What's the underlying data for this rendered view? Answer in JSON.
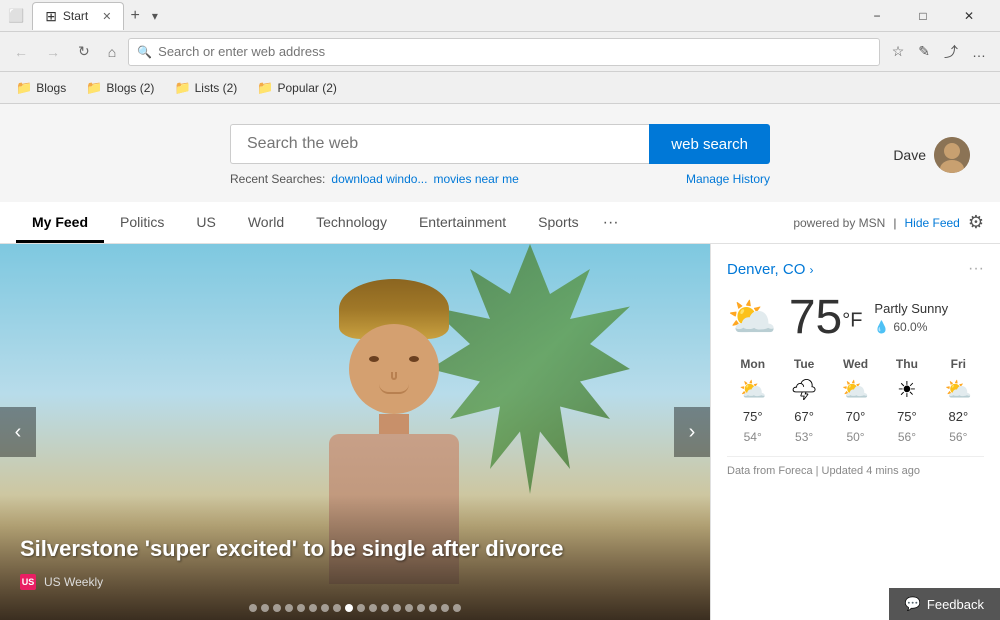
{
  "window": {
    "title": "Start",
    "min_label": "−",
    "max_label": "□",
    "close_label": "✕"
  },
  "address_bar": {
    "placeholder": "Search or enter web address",
    "back_icon": "←",
    "forward_icon": "→",
    "refresh_icon": "↻",
    "home_icon": "⌂",
    "favorite_icon": "☆",
    "reading_icon": "📖",
    "share_icon": "⤴",
    "more_icon": "…"
  },
  "bookmarks": [
    {
      "label": "Blogs",
      "type": "folder"
    },
    {
      "label": "Blogs (2)",
      "type": "folder"
    },
    {
      "label": "Lists (2)",
      "type": "folder"
    },
    {
      "label": "Popular (2)",
      "type": "folder"
    }
  ],
  "search": {
    "placeholder": "Search the web",
    "button_label": "web search",
    "recent_label": "Recent Searches:",
    "recent_items": [
      "download windo...",
      "movies near me"
    ],
    "manage_history": "Manage History"
  },
  "user": {
    "name": "Dave"
  },
  "feed": {
    "tabs": [
      {
        "label": "My Feed",
        "active": true
      },
      {
        "label": "Politics",
        "active": false
      },
      {
        "label": "US",
        "active": false
      },
      {
        "label": "World",
        "active": false
      },
      {
        "label": "Technology",
        "active": false
      },
      {
        "label": "Entertainment",
        "active": false
      },
      {
        "label": "Sports",
        "active": false
      }
    ],
    "more_label": "···",
    "powered_by": "powered by MSN",
    "hide_feed": "Hide Feed"
  },
  "article": {
    "title": "Silverstone 'super excited' to be single after divorce",
    "source": "US Weekly",
    "prev_label": "‹",
    "next_label": "›"
  },
  "weather": {
    "city": "Denver, CO",
    "arrow": "›",
    "temperature": "75",
    "unit": "°F",
    "condition": "Partly Sunny",
    "rain_chance": "60.0%",
    "rain_label": "💧",
    "forecast": [
      {
        "day": "Mon",
        "icon": "⛅",
        "high": "75°",
        "low": "54°"
      },
      {
        "day": "Tue",
        "icon": "🌩",
        "high": "67°",
        "low": "53°"
      },
      {
        "day": "Wed",
        "icon": "⛅",
        "high": "70°",
        "low": "50°"
      },
      {
        "day": "Thu",
        "icon": "☀",
        "high": "75°",
        "low": "56°"
      },
      {
        "day": "Fri",
        "icon": "⛅",
        "high": "82°",
        "low": "56°"
      }
    ],
    "footer": "Data from Foreca | Updated 4 mins ago"
  },
  "feedback": {
    "label": "Feedback"
  }
}
